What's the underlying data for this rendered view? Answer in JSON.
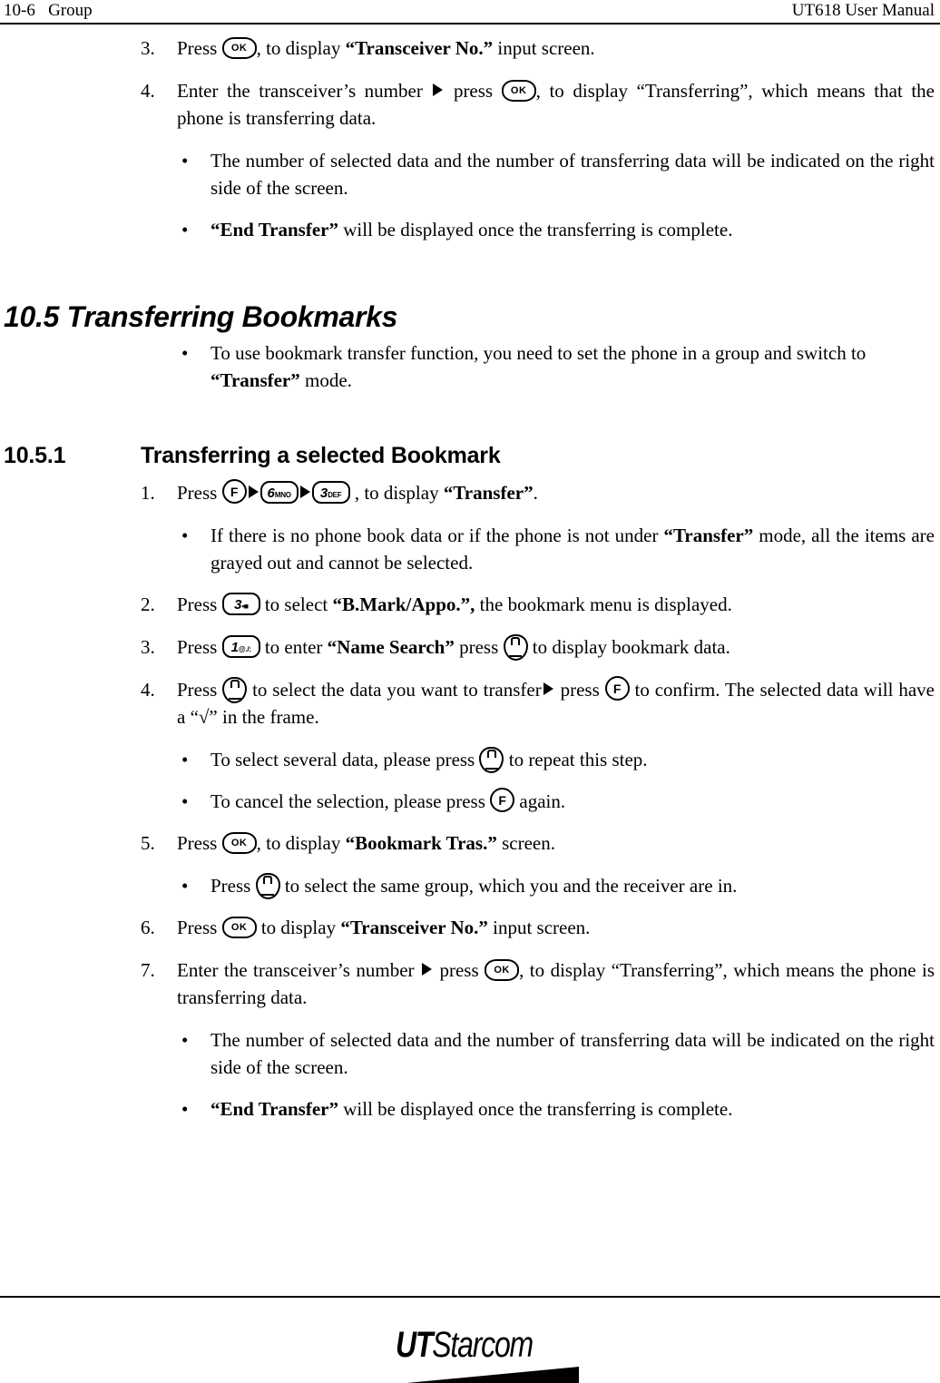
{
  "page": {
    "header_left": "10-6   Group",
    "header_right": "UT618 User Manual"
  },
  "keys": {
    "ok": "OK",
    "f": "F",
    "k1_big": "1",
    "k1_sub": "@./:",
    "k3_big": "3",
    "k3_sub": "DEF",
    "k3m_big": "3",
    "k3m_sub": "▪■",
    "k6_big": "6",
    "k6_sub": "MNO",
    "nav": "navigation-key"
  },
  "top_steps": [
    {
      "num": "3.",
      "pre": "Press ",
      "key": "ok",
      "post_plain_1": ", to display ",
      "post_bold": "“Transceiver No.”",
      "post_plain_2": " input screen."
    },
    {
      "num": "4.",
      "pre": "Enter the transceiver’s number ",
      "mid": " press ",
      "key": "ok",
      "post": ", to display “Transferring”, which means that the phone is transferring data."
    }
  ],
  "top_bullets": [
    {
      "text": "The number of selected data and the number of transferring data will be indicated on the right side of the screen."
    },
    {
      "bold": "“End Transfer”",
      "text": " will be displayed once the transferring is complete."
    }
  ],
  "section": {
    "number": "10.5",
    "title": "Transferring Bookmarks",
    "heading_full": "10.5 Transferring Bookmarks",
    "bullet": {
      "part1": "To use bookmark transfer function, you need to set the phone in a group and switch to ",
      "bold": "“Transfer”",
      "part2": " mode."
    }
  },
  "subsection": {
    "number": "10.5.1",
    "title": "Transferring a selected Bookmark"
  },
  "steps": [
    {
      "num": "1.",
      "pre": "Press ",
      "post_plain_1": " , to display  ",
      "post_bold": "“Transfer”",
      "post_plain_2": "."
    },
    {
      "num": "2.",
      "pre": "Press ",
      "post_plain_1": " to select ",
      "post_bold": "“B.Mark/Appo.”,",
      "post_plain_2": " the bookmark menu is displayed."
    },
    {
      "num": "3.",
      "pre": "Press ",
      "mid_plain_1": " to enter ",
      "mid_bold": "“Name Search”",
      "mid_plain_2": " press ",
      "post_plain": " to display bookmark data."
    },
    {
      "num": "4.",
      "pre": "Press ",
      "mid_plain_1": " to select the data you want to transfer",
      "mid_plain_2": " press ",
      "post_plain": " to confirm. The selected data will have a “√” in the frame."
    },
    {
      "num": "5.",
      "pre": "Press ",
      "post_plain_1": ", to display ",
      "post_bold": "“Bookmark Tras.”",
      "post_plain_2": " screen."
    },
    {
      "num": "6.",
      "pre": "Press ",
      "post_plain_1": " to display ",
      "post_bold": "“Transceiver No.”",
      "post_plain_2": " input screen."
    },
    {
      "num": "7.",
      "pre": "Enter the transceiver’s number ",
      "mid": " press ",
      "post": ", to display “Transferring”, which means the phone is transferring data."
    }
  ],
  "sub_bullets": {
    "step1": {
      "part1": "If there is no phone book data or if the phone is not under ",
      "bold": "“Transfer”",
      "part2": " mode, all the items are grayed out and cannot be selected."
    },
    "step4a": {
      "part1": "To select several data, please press ",
      "part2": " to repeat this step."
    },
    "step4b": {
      "part1": "To cancel the selection, please press ",
      "part2": " again."
    },
    "step5": {
      "part1": "Press ",
      "part2": " to select the same group, which you and the receiver are in."
    },
    "step7a": {
      "text": "The number of selected data and the number of transferring data will be indicated on the right side of the screen."
    },
    "step7b": {
      "bold": "“End Transfer”",
      "text": " will be displayed once the transferring is complete."
    }
  },
  "footer": {
    "logo_ut": "UT",
    "logo_starcom": "Starcom"
  }
}
